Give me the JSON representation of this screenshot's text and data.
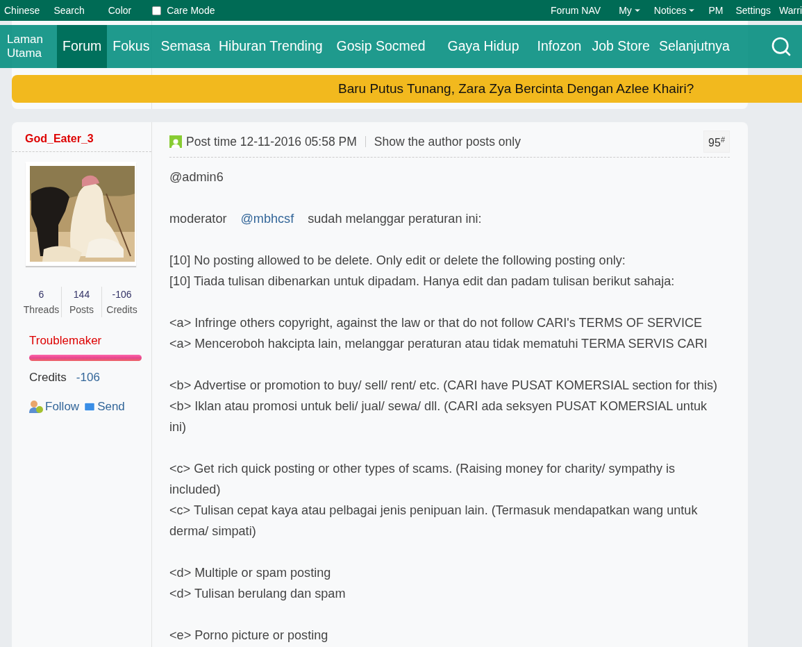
{
  "top_bar": {
    "left": [
      {
        "kind": "link",
        "label": "Chinese"
      },
      {
        "kind": "link",
        "label": "Search"
      },
      {
        "kind": "link",
        "label": "Color"
      },
      {
        "kind": "checkbox",
        "label": "Care Mode",
        "checked": false
      }
    ],
    "right": [
      {
        "label": "Forum NAV",
        "dropdown": false
      },
      {
        "label": "My",
        "dropdown": true
      },
      {
        "label": "Notices",
        "dropdown": true
      },
      {
        "label": "PM",
        "dropdown": false
      },
      {
        "label": "Settings",
        "dropdown": false
      },
      {
        "label": "Warri",
        "dropdown": false
      }
    ]
  },
  "nav": {
    "items": [
      {
        "label": "Laman Utama",
        "selected": false
      },
      {
        "label": "Forum",
        "selected": true
      },
      {
        "label": "Fokus",
        "selected": false
      },
      {
        "label": "Semasa",
        "selected": false
      },
      {
        "label": "Hiburan Trending",
        "selected": false
      },
      {
        "label": "Gosip Socmed",
        "selected": false
      },
      {
        "label": "Gaya Hidup",
        "selected": false
      },
      {
        "label": "Infozon",
        "selected": false
      },
      {
        "label": "Job Store",
        "selected": false
      },
      {
        "label": "Selanjutnya",
        "selected": false
      }
    ]
  },
  "banner": {
    "text": "Baru Putus Tunang, Zara Zya Bercinta Dengan Azlee Khairi?"
  },
  "post": {
    "author": "God_Eater_3",
    "avatar": {
      "kind": "picture"
    },
    "stats": [
      {
        "value": "6",
        "label": "Threads"
      },
      {
        "value": "144",
        "label": "Posts"
      },
      {
        "value": "-106",
        "label": "Credits"
      }
    ],
    "rank": "Troublemaker",
    "credits_label": "Credits",
    "credits_value": "-106",
    "actions": [
      {
        "kind": "follow",
        "label": "Follow"
      },
      {
        "kind": "send",
        "label": "Send"
      }
    ],
    "post_time": "Post time 12-11-2016 05:58 PM",
    "author_only": "Show the author posts only",
    "floor": "95$^{#}$",
    "blocks": [
      [
        {
          "kind": "text",
          "text": "@admin6"
        }
      ],
      [
        {
          "kind": "mention",
          "before": "moderator",
          "mention": "@mbhcsf",
          "after": "sudah melanggar peraturan ini:"
        }
      ],
      [
        {
          "kind": "text",
          "text": "[10] No posting allowed to be delete. Only edit or delete the following posting only:"
        },
        {
          "kind": "text",
          "text": "[10] Tiada tulisan dibenarkan untuk dipadam. Hanya edit dan padam tulisan berikut sahaja:"
        }
      ],
      [
        {
          "kind": "text",
          "text": "<a> Infringe others copyright, against the law or that do not follow CARI's TERMS OF SERVICE"
        },
        {
          "kind": "text",
          "text": "<a> Menceroboh hakcipta lain, melanggar peraturan atau tidak mematuhi TERMA SERVIS CARI"
        }
      ],
      [
        {
          "kind": "text",
          "text": "<b> Advertise or promotion to buy/ sell/ rent/ etc. (CARI have PUSAT KOMERSIAL section for this)"
        },
        {
          "kind": "text",
          "text": "<b> Iklan atau promosi untuk beli/ jual/ sewa/ dll. (CARI ada seksyen PUSAT KOMERSIAL untuk ini)"
        }
      ],
      [
        {
          "kind": "text",
          "text": "<c> Get rich quick posting or other types of scams. (Raising money for charity/ sympathy is included)"
        },
        {
          "kind": "text",
          "text": "<c> Tulisan cepat kaya atau pelbagai jenis penipuan lain. (Termasuk mendapatkan wang untuk derma/ simpati)"
        }
      ],
      [
        {
          "kind": "text",
          "text": "<d> Multiple or spam posting"
        },
        {
          "kind": "text",
          "text": "<d> Tulisan berulang dan spam"
        }
      ],
      [
        {
          "kind": "text",
          "text": "<e> Porno picture or posting"
        }
      ]
    ]
  }
}
